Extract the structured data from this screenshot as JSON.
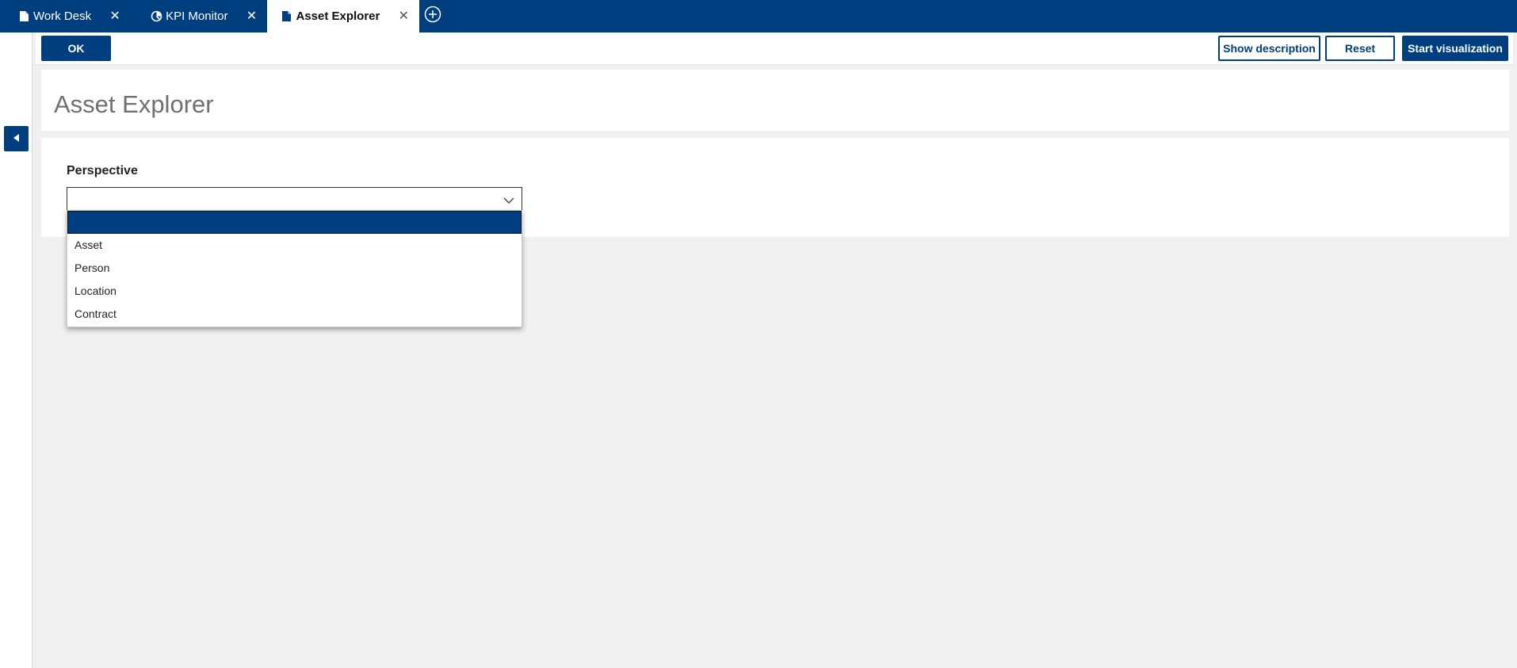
{
  "tabs": [
    {
      "label": "Work Desk",
      "icon": "document-icon",
      "close": "✕",
      "active": false
    },
    {
      "label": "KPI Monitor",
      "icon": "dashboard-gauge-icon",
      "close": "✕",
      "active": false
    },
    {
      "label": "Asset Explorer",
      "icon": "document-icon",
      "close": "✕",
      "active": true
    }
  ],
  "add_tab_icon": "plus-circle-icon",
  "toolbar": {
    "ok_label": "OK",
    "show_description_label": "Show description",
    "reset_label": "Reset",
    "start_visualization_label": "Start visualization"
  },
  "page": {
    "title": "Asset Explorer"
  },
  "form": {
    "perspective_label": "Perspective",
    "perspective_value": "",
    "options": [
      "",
      "Asset",
      "Person",
      "Location",
      "Contract"
    ],
    "highlighted_index": 0
  },
  "colors": {
    "brand": "#003f7f",
    "background": "#f0f0f0",
    "panel": "#ffffff",
    "title_text": "#707070"
  }
}
